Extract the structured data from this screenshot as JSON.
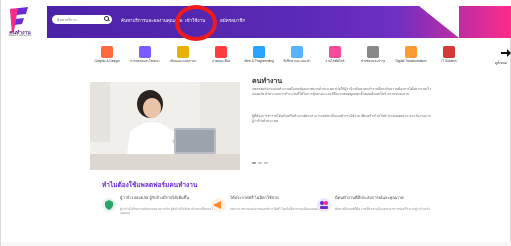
{
  "brand": {
    "name": "คนทำงาน",
    "tagline": "fastwork online jobs",
    "colors": {
      "primary": "#5b2ab6",
      "accent": "#ff2b8a",
      "highlight": "#f01a1a"
    }
  },
  "search": {
    "placeholder": "ค้นหาบริการ..."
  },
  "nav": {
    "items": [
      {
        "label": "ค้นหาบริการและผลงานคุณภาพ"
      },
      {
        "label": "เข้าใช้งาน"
      },
      {
        "label": "สมัครสมาชิก"
      }
    ]
  },
  "categories": [
    {
      "label": "Graphic & Design",
      "icon": "paintbrush-icon",
      "color": "#ff6a3d"
    },
    {
      "label": "การตลาดและโฆษณา",
      "icon": "megaphone-icon",
      "color": "#7c5cff"
    },
    {
      "label": "เขียนและแปลภาษา",
      "icon": "pencil-icon",
      "color": "#e7b10a"
    },
    {
      "label": "ภาพและเสียง",
      "icon": "film-icon",
      "color": "#ff3d3d"
    },
    {
      "label": "Web & Programming",
      "icon": "laptop-icon",
      "color": "#2aa3ff"
    },
    {
      "label": "ที่ปรึกษาและแนะนำ",
      "icon": "chat-icon",
      "color": "#55b3ff"
    },
    {
      "label": "งานไลฟ์สไตล์",
      "icon": "lifestyle-icon",
      "color": "#f74b9b"
    },
    {
      "label": "ช่างซ่อมและบำรุง",
      "icon": "tools-icon",
      "color": "#888888"
    },
    {
      "label": "Digital Transformation",
      "icon": "digital-icon",
      "color": "#ff9b2f"
    },
    {
      "label": "IT Solution",
      "icon": "it-icon",
      "color": "#d53a3a"
    }
  ],
  "nextLabel": "ดูทั้งหมด",
  "intro": {
    "title": "คนทำงาน",
    "p1": "แพลตฟอร์มรวมคนทำงานฟรีแลนซ์คุณภาพจากทั่วประเทศ ช่วยให้ผู้ว่าจ้างค้นหาคนทำงานที่ตรงกับความต้องการได้อย่างรวดเร็ว ปลอดภัย ด้วยระบบการชำระเงินที่ได้รับการคุ้มครอง และมีทีมงานคอยดูแลทุกขั้นตอนตั้งแต่เริ่มจ้างงานจนจบงาน",
    "p2": "ผู้ที่ต้องการหารายได้เสริมหรือทำงานอิสระสามารถสมัครเป็นคนทำงานได้ง่าย เพียงสร้างโปรไฟล์ นำเสนอผลงาน และรับงานจากผู้ว่าจ้างทั่วประเทศ"
  },
  "why": {
    "title": "ทำไมต้องใช้แพลตฟอร์มคนทำงาน",
    "features": [
      {
        "icon": "shield-icon",
        "title": "ผู้ว่าจ้างปลอดภัย ผู้รับจ้างมีรายได้เพิ่มขึ้น",
        "desc": "ผู้ว่าจ้างได้รับความคุ้มครองทางการเงิน ผู้รับจ้างได้รับค่าจ้างตามที่ตกลงไว้อย่างแน่นอน"
      },
      {
        "icon": "megaphone-icon",
        "title": "ได้ประกาศฟรี ไม่มีค่าใช้จ่าย",
        "desc": "ลงประกาศงานและนำเสนอบริการได้ฟรี โดยไม่มีค่าธรรมเนียมแอบแฝง"
      },
      {
        "icon": "team-icon",
        "title": "มีคนทำงานที่มีประสบการณ์และคุณภาพ",
        "desc": "ค้นหาฟรีแลนซ์ที่มีความเชี่ยวชาญในแต่ละสาขา พร้อมรีวิวจากผู้ว่าจ้างจริง"
      }
    ]
  }
}
